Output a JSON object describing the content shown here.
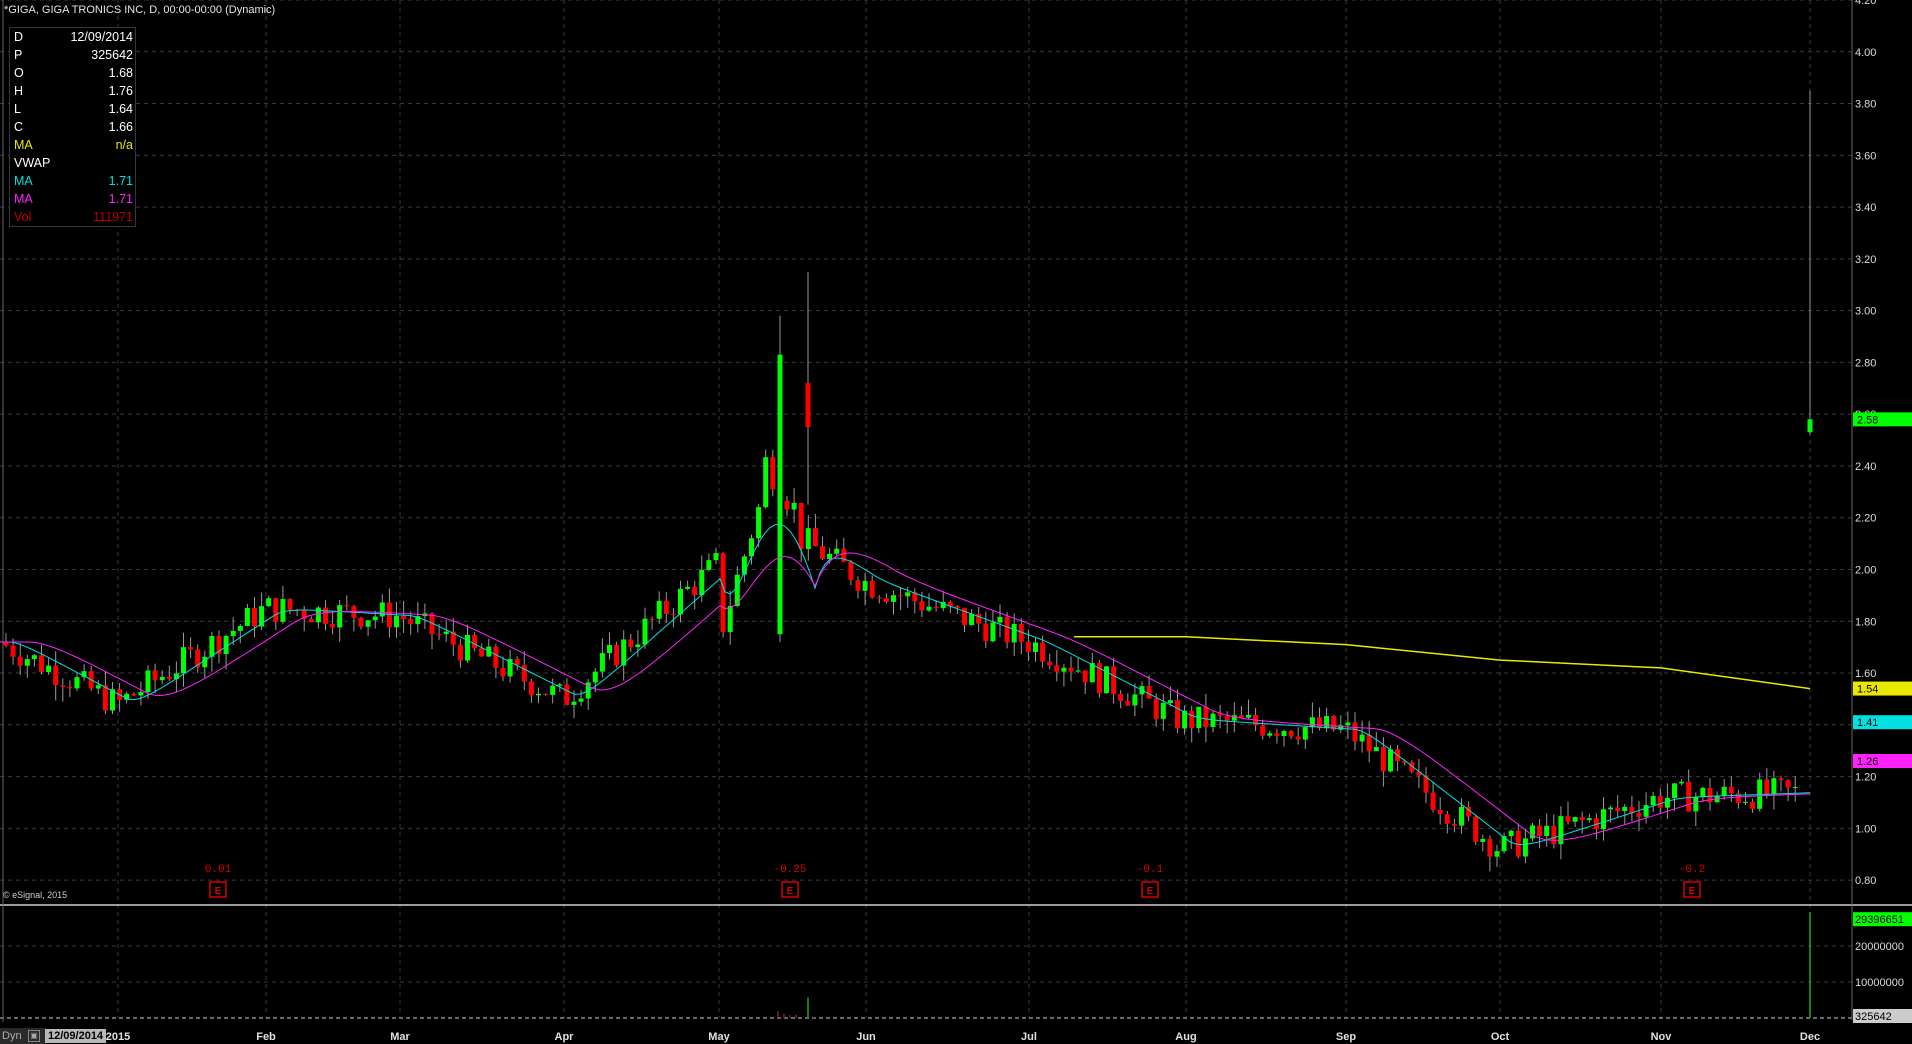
{
  "header": {
    "title": "GIGA, GIGA TRONICS INC, D, 00:00-00:00 (Dynamic)",
    "symbol_marker": "*"
  },
  "databox": {
    "rows": [
      {
        "key": "D",
        "value": "12/09/2014",
        "color": "#ffffff"
      },
      {
        "key": "P",
        "value": "325642",
        "color": "#ffffff"
      },
      {
        "key": "O",
        "value": "1.68",
        "color": "#ffffff"
      },
      {
        "key": "H",
        "value": "1.76",
        "color": "#ffffff"
      },
      {
        "key": "L",
        "value": "1.64",
        "color": "#ffffff"
      },
      {
        "key": "C",
        "value": "1.66",
        "color": "#ffffff"
      },
      {
        "key": "MA",
        "value": "n/a",
        "color": "#e8e800"
      },
      {
        "key": "VWAP",
        "value": "",
        "color": "#ffffff"
      },
      {
        "key": "MA",
        "value": "1.71",
        "color": "#00e0e0"
      },
      {
        "key": "MA",
        "value": "1.71",
        "color": "#ff22ff"
      },
      {
        "key": "Vol",
        "value": "111971",
        "color": "#c00000"
      }
    ]
  },
  "copyright": "© eSignal, 2015",
  "footer": {
    "dyn_label": "Dyn",
    "dyn_icon": "calendar-icon",
    "current_date": "12/09/2014"
  },
  "colors": {
    "up": "#00ff00",
    "down": "#ff0000",
    "ma_yellow": "#e8e800",
    "ma_cyan": "#00e0e0",
    "ma_magenta": "#ff22ff",
    "grid": "#3a3a3a",
    "earnings": "#d40000"
  },
  "chart_data": [
    {
      "type": "candlestick",
      "title": "GIGA, GIGA TRONICS INC, D",
      "y_ticks": [
        "0.80",
        "1.00",
        "1.20",
        "1.40",
        "1.60",
        "1.80",
        "2.00",
        "2.20",
        "2.40",
        "2.60",
        "2.80",
        "3.00",
        "3.20",
        "3.40",
        "3.60",
        "3.80",
        "4.00",
        "4.20"
      ],
      "ylim": [
        0.7,
        4.2
      ],
      "x_ticks": [
        "2015",
        "Feb",
        "Mar",
        "Apr",
        "May",
        "Jun",
        "Jul",
        "Aug",
        "Sep",
        "Oct",
        "Nov",
        "Dec"
      ],
      "grid": true,
      "right_axis_labels": [
        {
          "text": "2.58",
          "value": 2.58,
          "color": "#00ff00"
        },
        {
          "text": "1.54",
          "value": 1.54,
          "color": "#e8e800"
        },
        {
          "text": "1.41",
          "value": 1.41,
          "color": "#00e0e0"
        },
        {
          "text": "1.26",
          "value": 1.26,
          "color": "#ff22ff"
        }
      ],
      "earnings": [
        {
          "label": "0.01",
          "month_index": 1
        },
        {
          "label": "-0.25",
          "month_index": 5
        },
        {
          "label": "-0.1",
          "month_index": 7
        },
        {
          "label": "-0.2",
          "month_index": 10
        }
      ],
      "key_points": [
        {
          "label": "Jan",
          "value": 1.7
        },
        {
          "label": "Feb",
          "value": 1.85
        },
        {
          "label": "Mar",
          "value": 1.82
        },
        {
          "label": "Apr",
          "value": 1.55
        },
        {
          "label": "May peak",
          "value": 2.83
        },
        {
          "label": "Jun",
          "value": 1.95
        },
        {
          "label": "Jul",
          "value": 1.7
        },
        {
          "label": "Aug",
          "value": 1.45
        },
        {
          "label": "Sep",
          "value": 1.4
        },
        {
          "label": "Oct",
          "value": 0.93
        },
        {
          "label": "Nov",
          "value": 1.12
        },
        {
          "label": "Dec last",
          "value": 2.58
        },
        {
          "label": "Dec high",
          "value": 3.85
        }
      ]
    },
    {
      "type": "bar",
      "title": "Volume",
      "y_ticks": [
        "10000000",
        "20000000"
      ],
      "ylim": [
        0,
        30000000
      ],
      "right_axis_labels": [
        {
          "text": "29396651",
          "value": 29396651,
          "color": "#00ff00"
        },
        {
          "text": "325642",
          "value": 325642,
          "color": "#cccccc"
        }
      ],
      "notable_bars": [
        {
          "label": "May spike",
          "value": 5700000
        },
        {
          "label": "Dec spike",
          "value": 29396651
        }
      ]
    }
  ]
}
